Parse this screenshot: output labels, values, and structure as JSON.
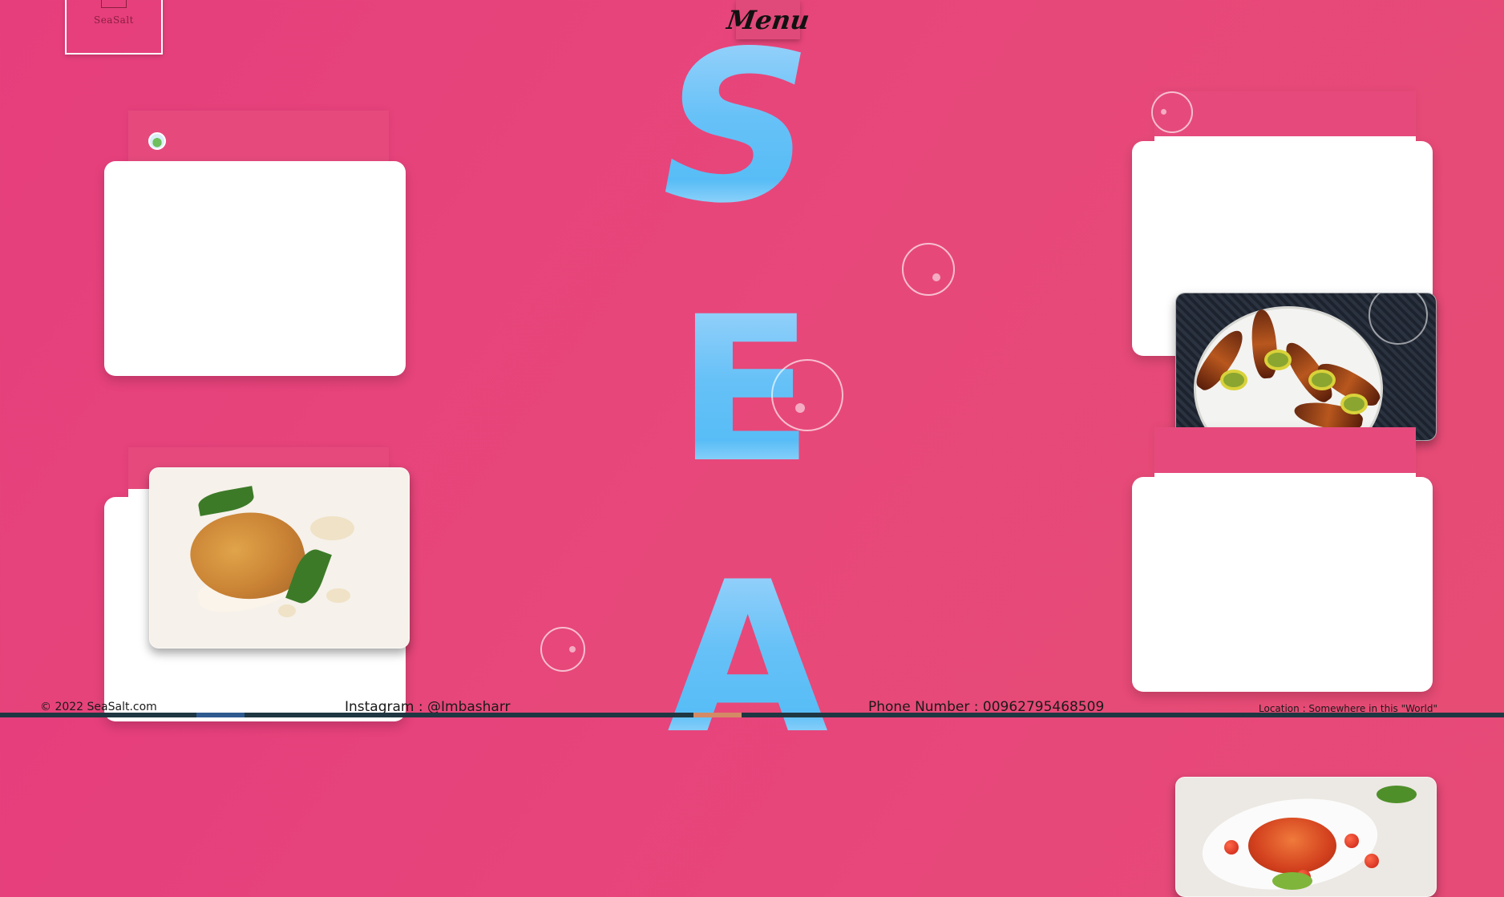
{
  "brand": {
    "logo_text": "SeaSalt"
  },
  "nav": {
    "menu_label": "Menu"
  },
  "hero": {
    "letters": [
      "S",
      "E",
      "A"
    ]
  },
  "footer": {
    "copyright": "© 2022 SeaSalt.com",
    "instagram": "Instagram : @Imbasharr",
    "phone": "Phone Number : 00962795468509",
    "location": "Location : Somewhere in this \"World\""
  },
  "colors": {
    "background": "#e6457a",
    "sky_letters": "#66c1f7",
    "card": "#ffffff",
    "footer_bar": "#1f3742"
  }
}
